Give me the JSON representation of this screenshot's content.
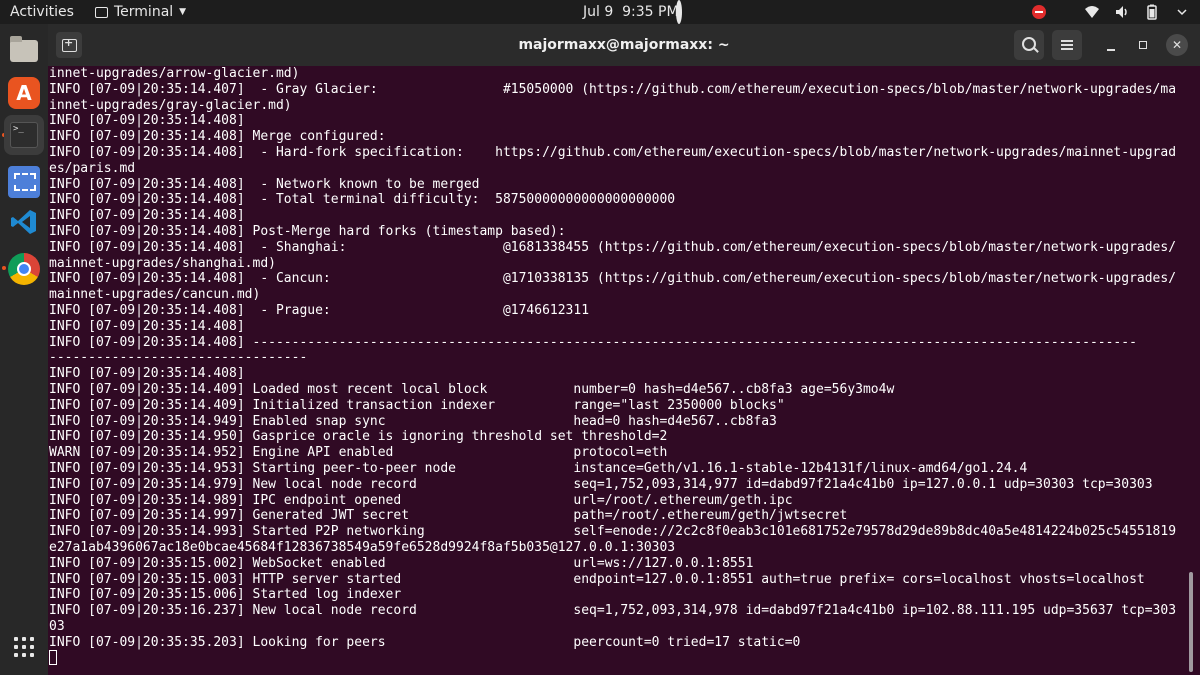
{
  "topbar": {
    "activities": "Activities",
    "app_name": "Terminal",
    "app_menu_icon": "chevron-down-icon",
    "clock": "Jul 9  9:35 PM",
    "tray_icons": [
      "do-not-disturb-icon",
      "wifi-icon",
      "volume-icon",
      "battery-icon",
      "power-menu-icon"
    ],
    "accent_color": "#e12c2c"
  },
  "dock": {
    "items": [
      "files-icon",
      "software-center-icon",
      "terminal-icon",
      "screenshot-icon",
      "vscode-icon",
      "chrome-icon",
      "show-applications-icon"
    ],
    "software_glyph": "A",
    "terminal_glyph": ">_"
  },
  "window": {
    "title": "majormaxx@majormaxx: ~",
    "close_glyph": "✕",
    "background": "#300a24"
  },
  "terminal": {
    "lines": [
      "innet-upgrades/arrow-glacier.md)",
      "INFO [07-09|20:35:14.407]  - Gray Glacier:                #15050000 (https://github.com/ethereum/execution-specs/blob/master/network-upgrades/ma",
      "innet-upgrades/gray-glacier.md)",
      "INFO [07-09|20:35:14.408]",
      "INFO [07-09|20:35:14.408] Merge configured:",
      "INFO [07-09|20:35:14.408]  - Hard-fork specification:    https://github.com/ethereum/execution-specs/blob/master/network-upgrades/mainnet-upgrad",
      "es/paris.md",
      "INFO [07-09|20:35:14.408]  - Network known to be merged",
      "INFO [07-09|20:35:14.408]  - Total terminal difficulty:  58750000000000000000000",
      "INFO [07-09|20:35:14.408]",
      "INFO [07-09|20:35:14.408] Post-Merge hard forks (timestamp based):",
      "INFO [07-09|20:35:14.408]  - Shanghai:                    @1681338455 (https://github.com/ethereum/execution-specs/blob/master/network-upgrades/",
      "mainnet-upgrades/shanghai.md)",
      "INFO [07-09|20:35:14.408]  - Cancun:                      @1710338135 (https://github.com/ethereum/execution-specs/blob/master/network-upgrades/",
      "mainnet-upgrades/cancun.md)",
      "INFO [07-09|20:35:14.408]  - Prague:                      @1746612311",
      "INFO [07-09|20:35:14.408]",
      "INFO [07-09|20:35:14.408] -----------------------------------------------------------------------------------------------------------------",
      "---------------------------------",
      "INFO [07-09|20:35:14.408]",
      "INFO [07-09|20:35:14.409] Loaded most recent local block           number=0 hash=d4e567..cb8fa3 age=56y3mo4w",
      "INFO [07-09|20:35:14.409] Initialized transaction indexer          range=\"last 2350000 blocks\"",
      "INFO [07-09|20:35:14.949] Enabled snap sync                        head=0 hash=d4e567..cb8fa3",
      "INFO [07-09|20:35:14.950] Gasprice oracle is ignoring threshold set threshold=2",
      "WARN [07-09|20:35:14.952] Engine API enabled                       protocol=eth",
      "INFO [07-09|20:35:14.953] Starting peer-to-peer node               instance=Geth/v1.16.1-stable-12b4131f/linux-amd64/go1.24.4",
      "INFO [07-09|20:35:14.979] New local node record                    seq=1,752,093,314,977 id=dabd97f21a4c41b0 ip=127.0.0.1 udp=30303 tcp=30303",
      "INFO [07-09|20:35:14.989] IPC endpoint opened                      url=/root/.ethereum/geth.ipc",
      "INFO [07-09|20:35:14.997] Generated JWT secret                     path=/root/.ethereum/geth/jwtsecret",
      "INFO [07-09|20:35:14.993] Started P2P networking                   self=enode://2c2c8f0eab3c101e681752e79578d29de89b8dc40a5e4814224b025c54551819",
      "e27a1ab4396067ac18e0bcae45684f12836738549a59fe6528d9924f8af5b035@127.0.0.1:30303",
      "INFO [07-09|20:35:15.002] WebSocket enabled                        url=ws://127.0.0.1:8551",
      "INFO [07-09|20:35:15.003] HTTP server started                      endpoint=127.0.0.1:8551 auth=true prefix= cors=localhost vhosts=localhost",
      "INFO [07-09|20:35:15.006] Started log indexer",
      "INFO [07-09|20:35:16.237] New local node record                    seq=1,752,093,314,978 id=dabd97f21a4c41b0 ip=102.88.111.195 udp=35637 tcp=303",
      "03",
      "INFO [07-09|20:35:35.203] Looking for peers                        peercount=0 tried=17 static=0"
    ]
  }
}
